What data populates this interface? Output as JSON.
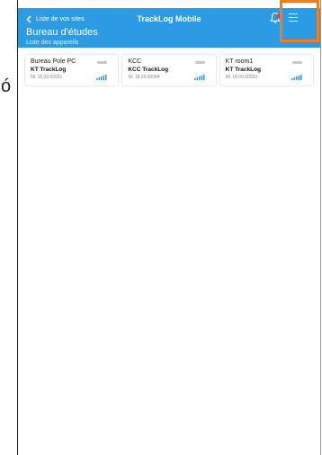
{
  "stray_text": "ó",
  "header": {
    "back_label": "Liste de vos sites",
    "app_title": "TrackLog Mobile",
    "page_title": "Bureau d'études",
    "page_subtitle": "Liste des appareils",
    "colors": {
      "header_bg": "#2c9be3",
      "highlight": "#f47b20",
      "badge": "#e53935"
    }
  },
  "devices": [
    {
      "name": "Bureau Pole PC",
      "model": "KT TrackLog",
      "serial": "6K 18.09.00051"
    },
    {
      "name": "KCC",
      "model": "KCC TrackLog",
      "serial": "6K 18.09.00084"
    },
    {
      "name": "KT room1",
      "model": "KT TrackLog",
      "serial": "6K 18.09.00050"
    }
  ]
}
